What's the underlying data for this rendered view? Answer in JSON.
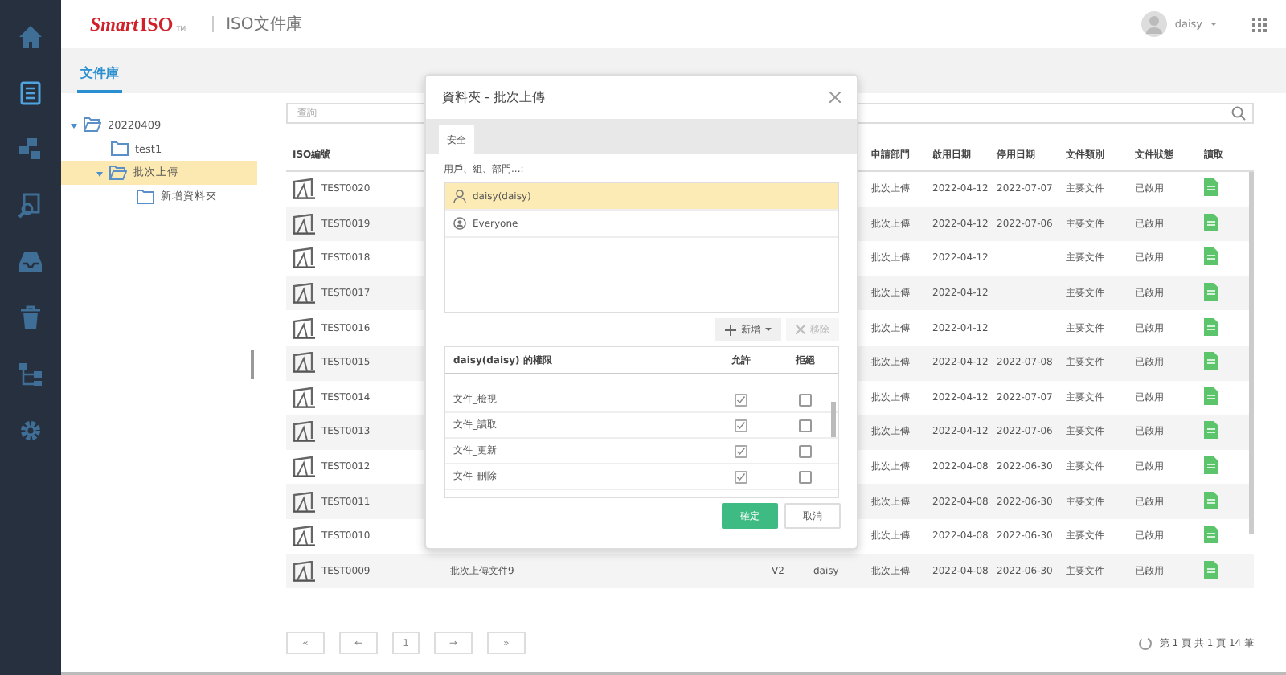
{
  "header": {
    "logo_brand": "Smart",
    "logo_iso": "ISO",
    "logo_tm": "TM",
    "title": "ISO文件庫",
    "user": "daisy"
  },
  "sidebar": {
    "items": [
      {
        "kind": "home",
        "selected": false
      },
      {
        "kind": "document",
        "selected": true
      },
      {
        "kind": "modules",
        "selected": false
      },
      {
        "kind": "search",
        "selected": false
      },
      {
        "kind": "inbox",
        "selected": false
      },
      {
        "kind": "trash",
        "selected": false
      },
      {
        "kind": "flow",
        "selected": false
      },
      {
        "kind": "settings",
        "selected": false
      }
    ]
  },
  "tabs": [
    {
      "label": "文件庫",
      "selected": true
    }
  ],
  "tree": [
    {
      "label": "20220409",
      "expanded": true,
      "selected": false,
      "children": [
        {
          "label": "test1",
          "selected": false
        },
        {
          "label": "批次上傳",
          "expanded": true,
          "selected": true,
          "children": [
            {
              "label": "新增資料夾",
              "selected": false
            }
          ]
        }
      ]
    }
  ],
  "search": {
    "placeholder": "查詢"
  },
  "table": {
    "columns": [
      "ISO編號",
      "申請部門",
      "啟用日期",
      "停用日期",
      "文件類別",
      "文件狀態",
      "讀取"
    ],
    "rows": [
      {
        "iso": "TEST0020",
        "dept": "批次上傳",
        "start": "2022-04-12",
        "end": "2022-07-07",
        "category": "主要文件",
        "status": "已啟用"
      },
      {
        "iso": "TEST0019",
        "dept": "批次上傳",
        "start": "2022-04-12",
        "end": "2022-07-06",
        "category": "主要文件",
        "status": "已啟用"
      },
      {
        "iso": "TEST0018",
        "dept": "批次上傳",
        "start": "2022-04-12",
        "category": "主要文件",
        "status": "已啟用"
      },
      {
        "iso": "TEST0017",
        "dept": "批次上傳",
        "start": "2022-04-12",
        "category": "主要文件",
        "status": "已啟用"
      },
      {
        "iso": "TEST0016",
        "dept": "批次上傳",
        "start": "2022-04-12",
        "category": "主要文件",
        "status": "已啟用"
      },
      {
        "iso": "TEST0015",
        "dept": "批次上傳",
        "start": "2022-04-12",
        "end": "2022-07-08",
        "category": "主要文件",
        "status": "已啟用"
      },
      {
        "iso": "TEST0014",
        "dept": "批次上傳",
        "start": "2022-04-12",
        "end": "2022-07-07",
        "category": "主要文件",
        "status": "已啟用"
      },
      {
        "iso": "TEST0013",
        "dept": "批次上傳",
        "start": "2022-04-12",
        "end": "2022-07-06",
        "category": "主要文件",
        "status": "已啟用"
      },
      {
        "iso": "TEST0012",
        "dept": "批次上傳",
        "start": "2022-04-08",
        "end": "2022-06-30",
        "category": "主要文件",
        "status": "已啟用"
      },
      {
        "iso": "TEST0011",
        "dept": "批次上傳",
        "start": "2022-04-08",
        "end": "2022-06-30",
        "category": "主要文件",
        "status": "已啟用"
      },
      {
        "iso": "TEST0010",
        "dept": "批次上傳",
        "start": "2022-04-08",
        "end": "2022-06-30",
        "category": "主要文件",
        "status": "已啟用"
      },
      {
        "iso": "TEST0009",
        "name": "批次上傳文件9",
        "version": "V2",
        "owner": "daisy",
        "dept": "批次上傳",
        "start": "2022-04-08",
        "end": "2022-06-30",
        "category": "主要文件",
        "status": "已啟用"
      }
    ]
  },
  "pagination": {
    "buttons": [
      "«",
      "←",
      "1",
      "→",
      "»"
    ],
    "summary": "第 1 頁 共 1 頁 14 筆"
  },
  "dialog": {
    "title": "資料夾 - 批次上傳",
    "tabs": [
      {
        "label": "安全",
        "selected": true
      }
    ],
    "principals_label": "用戶、組、部門...:",
    "principals": [
      {
        "kind": "user",
        "label": "daisy(daisy)",
        "selected": true
      },
      {
        "kind": "group",
        "label": "Everyone",
        "selected": false
      }
    ],
    "add_button": "新增",
    "remove_button": "移除",
    "permissions_title": "daisy(daisy) 的權限",
    "permission_columns": [
      "允許",
      "拒絕"
    ],
    "permissions": [
      {
        "label": "文件_檢視",
        "allow": true,
        "deny": false
      },
      {
        "label": "文件_讀取",
        "allow": true,
        "deny": false
      },
      {
        "label": "文件_更新",
        "allow": true,
        "deny": false
      },
      {
        "label": "文件_刪除",
        "allow": true,
        "deny": false
      }
    ],
    "ok_button": "確定",
    "cancel_button": "取消"
  }
}
